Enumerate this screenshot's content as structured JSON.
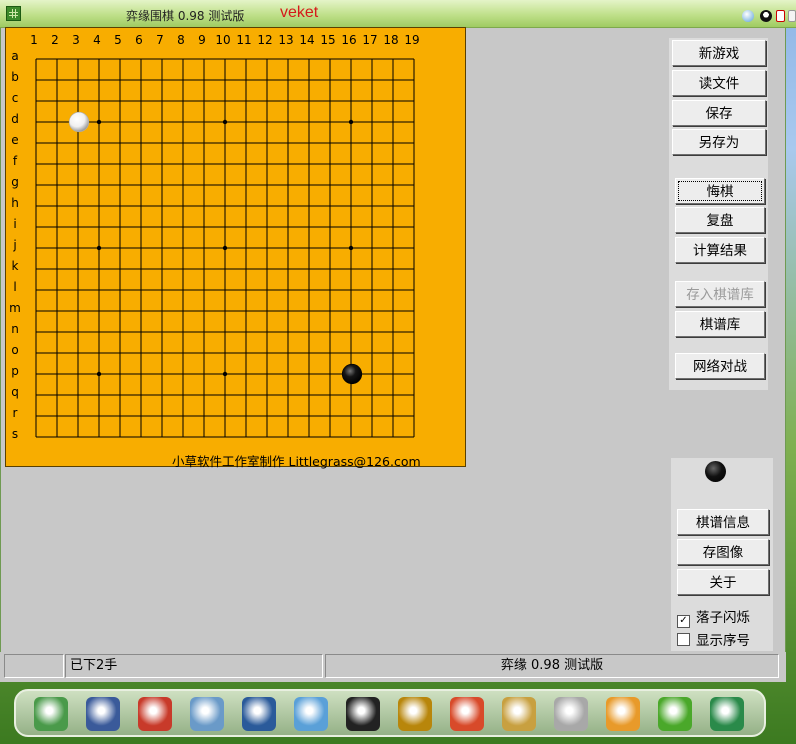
{
  "window": {
    "title": "弈缘围棋 0.98 测试版",
    "user": "veket"
  },
  "board": {
    "size": 19,
    "col_labels": [
      "1",
      "2",
      "3",
      "4",
      "5",
      "6",
      "7",
      "8",
      "9",
      "10",
      "11",
      "12",
      "13",
      "14",
      "15",
      "16",
      "17",
      "18",
      "19"
    ],
    "row_labels": [
      "a",
      "b",
      "c",
      "d",
      "e",
      "f",
      "g",
      "h",
      "i",
      "j",
      "k",
      "l",
      "m",
      "n",
      "o",
      "p",
      "q",
      "r",
      "s"
    ],
    "stones": [
      {
        "color": "white",
        "col": 3,
        "row": "d"
      },
      {
        "color": "black",
        "col": 16,
        "row": "p"
      }
    ],
    "credit": "小草软件工作室制作 Littlegrass@126.com"
  },
  "sidebar": {
    "new_game": "新游戏",
    "open_file": "读文件",
    "save": "保存",
    "save_as": "另存为",
    "undo": "悔棋",
    "review": "复盘",
    "count_result": "计算结果",
    "add_to_library": "存入棋谱库",
    "library": "棋谱库",
    "online_play": "网络对战",
    "game_info": "棋谱信息",
    "save_image": "存图像",
    "about": "关于",
    "flash_stone_label": "落子闪烁",
    "flash_stone_checked": true,
    "show_numbers_label": "显示序号",
    "show_numbers_checked": false,
    "next_to_move": "black"
  },
  "status": {
    "moves": "已下2手",
    "version": "弈缘 0.98 测试版"
  },
  "taskbar": {
    "icons": [
      "image-viewer-icon",
      "monitor-icon",
      "squirrel-icon",
      "notes-icon",
      "media-player-icon",
      "network-user-icon",
      "penguin-chat-icon",
      "file-manager-icon",
      "chart-icon",
      "paint-icon",
      "usb-drive-icon",
      "photo-icon",
      "help-icon",
      "camera-icon"
    ]
  },
  "colors": {
    "board": "#f8ad00",
    "titlebar": "#bfe08a",
    "title_user": "#d51a1a"
  }
}
